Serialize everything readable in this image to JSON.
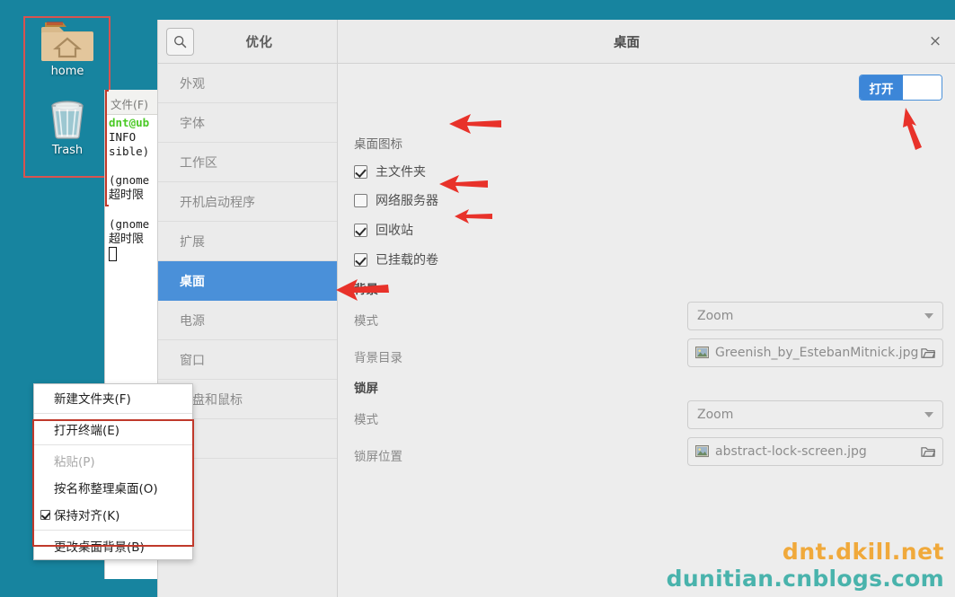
{
  "desktop": {
    "background_color": "#17849f",
    "icons": [
      {
        "name": "home-folder-icon",
        "label": "home"
      },
      {
        "name": "trash-icon",
        "label": "Trash"
      }
    ]
  },
  "terminal": {
    "menu_file": "文件(F)",
    "lines": [
      "dnt@ub",
      "INFO",
      "sible)",
      "",
      "(gnome",
      "超时限",
      "",
      "(gnome",
      "超时限"
    ]
  },
  "tweaks": {
    "app_title": "优化",
    "page_title": "桌面",
    "close_label": "×",
    "search_icon": "search-icon",
    "sidebar": [
      {
        "label": "外观",
        "selected": false
      },
      {
        "label": "字体",
        "selected": false
      },
      {
        "label": "工作区",
        "selected": false
      },
      {
        "label": "开机启动程序",
        "selected": false
      },
      {
        "label": "扩展",
        "selected": false
      },
      {
        "label": "桌面",
        "selected": true
      },
      {
        "label": "电源",
        "selected": false
      },
      {
        "label": "窗口",
        "selected": false
      },
      {
        "label": "键盘和鼠标",
        "selected": false
      },
      {
        "label": "",
        "selected": false
      }
    ],
    "toggle": {
      "label": "打开",
      "state": "on",
      "accent": "#3c86d8"
    },
    "sections": {
      "icons_group": "桌面图标",
      "background_group": "背景",
      "lockscreen_group": "锁屏"
    },
    "checkboxes": [
      {
        "label": "主文件夹",
        "checked": true
      },
      {
        "label": "网络服务器",
        "checked": false
      },
      {
        "label": "回收站",
        "checked": true
      },
      {
        "label": "已挂载的卷",
        "checked": true
      }
    ],
    "background": {
      "mode_label": "模式",
      "mode_value": "Zoom",
      "dir_label": "背景目录",
      "dir_value": "Greenish_by_EstebanMitnick.jpg"
    },
    "lockscreen": {
      "mode_label": "模式",
      "mode_value": "Zoom",
      "pos_label": "锁屏位置",
      "pos_value": "abstract-lock-screen.jpg"
    }
  },
  "context_menu": {
    "items": [
      {
        "label": "新建文件夹(F)",
        "disabled": false,
        "checked": false,
        "separator_after": true
      },
      {
        "label": "打开终端(E)",
        "disabled": false,
        "checked": false,
        "separator_after": true
      },
      {
        "label": "粘贴(P)",
        "disabled": true,
        "checked": false,
        "separator_after": false
      },
      {
        "label": "按名称整理桌面(O)",
        "disabled": false,
        "checked": false,
        "separator_after": false
      },
      {
        "label": "保持对齐(K)",
        "disabled": false,
        "checked": true,
        "separator_after": true
      },
      {
        "label": "更改桌面背景(B)",
        "disabled": false,
        "checked": false,
        "separator_after": false
      }
    ]
  },
  "annotations": {
    "arrow_color": "#e8322a",
    "highlight_box_color": "#c0392b",
    "arrow_count": 5
  },
  "watermark": {
    "line1": "dnt.dkill.net",
    "line2": "dunitian.cnblogs.com",
    "line1_color": "#f0a93b",
    "line2_color": "#49b3ac"
  }
}
